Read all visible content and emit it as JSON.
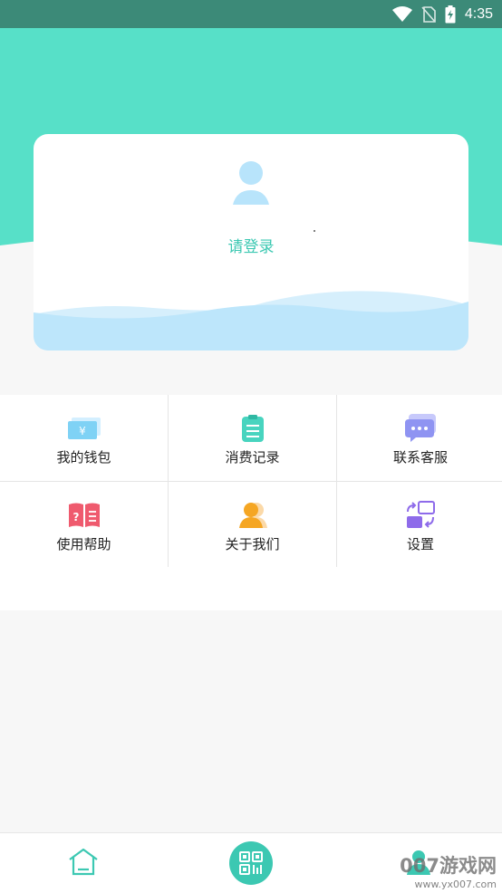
{
  "status_bar": {
    "time": "4:35",
    "background": "#3c8a78"
  },
  "header": {
    "background": "#57e0c8"
  },
  "card": {
    "login_text": "请登录",
    "avatar_color": "#b8e4fb",
    "wave_color": "#bde6fb"
  },
  "menu": {
    "items": [
      {
        "label": "我的钱包",
        "icon": "wallet-icon",
        "color": "#7fd2f5"
      },
      {
        "label": "消费记录",
        "icon": "clipboard-icon",
        "color": "#48d4bf"
      },
      {
        "label": "联系客服",
        "icon": "chat-bubble-icon",
        "color": "#8f94f2"
      },
      {
        "label": "使用帮助",
        "icon": "help-book-icon",
        "color": "#ef5a6e"
      },
      {
        "label": "关于我们",
        "icon": "person-icon",
        "color": "#f5a623"
      },
      {
        "label": "设置",
        "icon": "switch-settings-icon",
        "color": "#8e6bea"
      }
    ]
  },
  "bottom_nav": {
    "items": [
      {
        "icon": "home-icon"
      },
      {
        "icon": "qr-scan-icon"
      },
      {
        "icon": "mine-icon"
      }
    ],
    "accent": "#3cc8b2"
  },
  "watermark": {
    "title": "007游戏网",
    "url": "www.yx007.com"
  }
}
